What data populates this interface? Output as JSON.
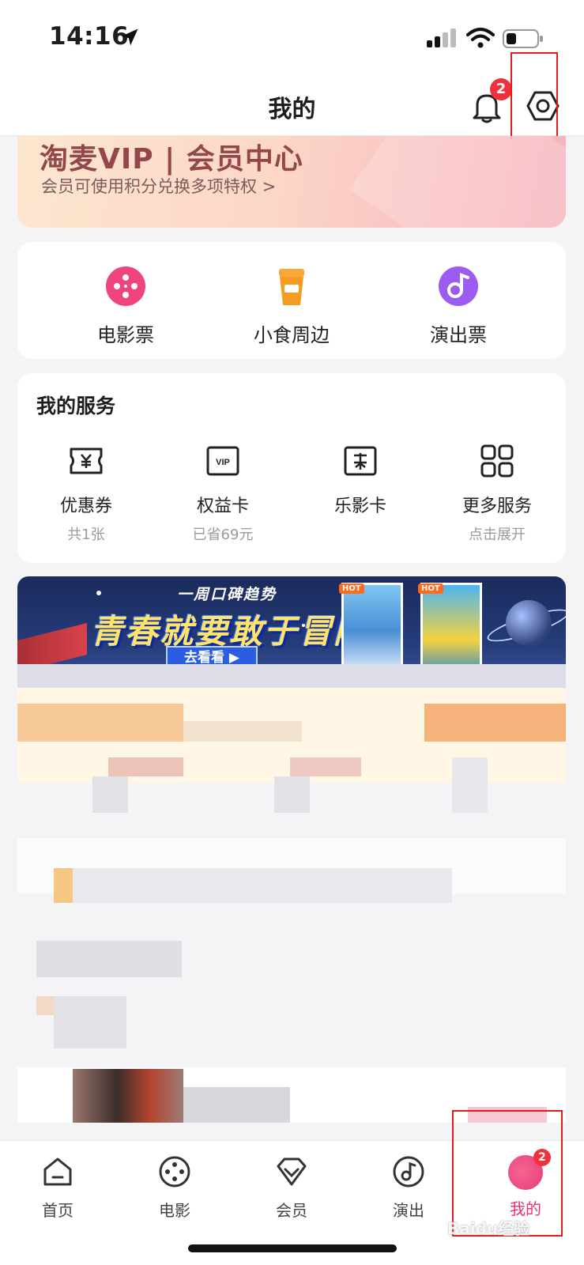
{
  "status_bar": {
    "time": "14:16"
  },
  "header": {
    "title": "我的",
    "notification_count": "2"
  },
  "vip_banner": {
    "title": "淘麦VIP | 会员中心",
    "subtitle": "会员可使用积分兑换多项特权 >"
  },
  "quick_entries": [
    {
      "label": "电影票",
      "icon": "film-reel-icon",
      "color": "#f0457c"
    },
    {
      "label": "小食周边",
      "icon": "drink-cup-icon",
      "color": "#f59c24"
    },
    {
      "label": "演出票",
      "icon": "music-note-icon",
      "color": "#9c5cf0"
    }
  ],
  "services": {
    "title": "我的服务",
    "items": [
      {
        "label": "优惠券",
        "sub": "共1张",
        "icon": "coupon-icon"
      },
      {
        "label": "权益卡",
        "sub": "已省69元",
        "icon": "vip-card-icon"
      },
      {
        "label": "乐影卡",
        "sub": "",
        "icon": "film-card-icon"
      },
      {
        "label": "更多服务",
        "sub": "点击展开",
        "icon": "grid-icon"
      }
    ]
  },
  "promo": {
    "small_text": "一周口碑趋势",
    "big_text": "青春就要敢于冒险",
    "button": "去看看 ▶",
    "hot_tag": "HOT"
  },
  "tab_bar": {
    "items": [
      {
        "label": "首页",
        "icon": "home-icon"
      },
      {
        "label": "电影",
        "icon": "film-reel-icon"
      },
      {
        "label": "会员",
        "icon": "diamond-icon"
      },
      {
        "label": "演出",
        "icon": "music-note-icon"
      },
      {
        "label": "我的",
        "icon": "avatar-icon",
        "badge": "2"
      }
    ]
  },
  "watermark": "Baidu经验"
}
